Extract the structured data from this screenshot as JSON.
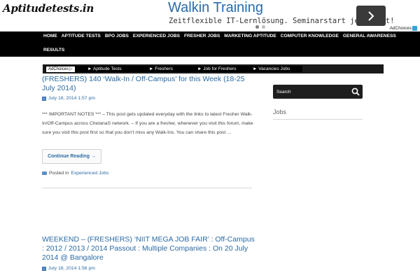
{
  "header": {
    "logo": "Aptitudetests.in",
    "ad": {
      "title": "Walkin Training",
      "subtitle": "Zeitflexible IT-Lernlösung. Seminarstart jederzeit!",
      "adchoices": "AdChoices",
      "arrow_icon": "chevron-right-icon"
    }
  },
  "nav": {
    "row1": [
      "HOME",
      "APTITUDE TESTS",
      "BPO JOBS",
      "EXPERIENCED JOBS",
      "FRESHER JOBS",
      "MARKETING APTITUDE",
      "COMPUTER KNOWLEDGE",
      "GENERAL AWARENESS"
    ],
    "row2": [
      "RESULTS"
    ]
  },
  "ad_links": {
    "adchoices": "AdChoices",
    "links": [
      "► Aptitude Tests",
      "► Freshers",
      "► Job for Freshers",
      "► Vacancies Jobs"
    ]
  },
  "posts": [
    {
      "title": "(FRESHERS) 140 ‘Walk-In / Off-Campus’ for this Week (18-25 July 2014)",
      "date": "July 18, 2014 1:57 pm",
      "excerpt": "*** IMPORTANT NOTES *** – This post gets updated everyday with the links to latest Fresher Walk-In/Off-Campus across ChetanaS network. – If you are a fresher, whenever you visit this forum, make sure you visit this post first so that you don’t miss any Walk-Ins. You can share this post …",
      "continue_label": "Continue Reading →",
      "posted_in_label": "Posted in",
      "category": "Experienced Jobs"
    },
    {
      "title": "WEEKEND – (FRESHERS) ‘NIIT MEGA JOB FAIR’ : Off-Campus : 2012 / 2013 / 2014 Passout : Multiple Companies : On 20 July 2014 @ Bangalore",
      "date": "July 18, 2014 1:56 pm"
    }
  ],
  "sidebar": {
    "search_placeholder": "Search",
    "widget_title": "Jobs"
  },
  "colors": {
    "link": "#2b6aa3",
    "nav_bg": "#000000",
    "ad_title": "#2a6aa8"
  }
}
